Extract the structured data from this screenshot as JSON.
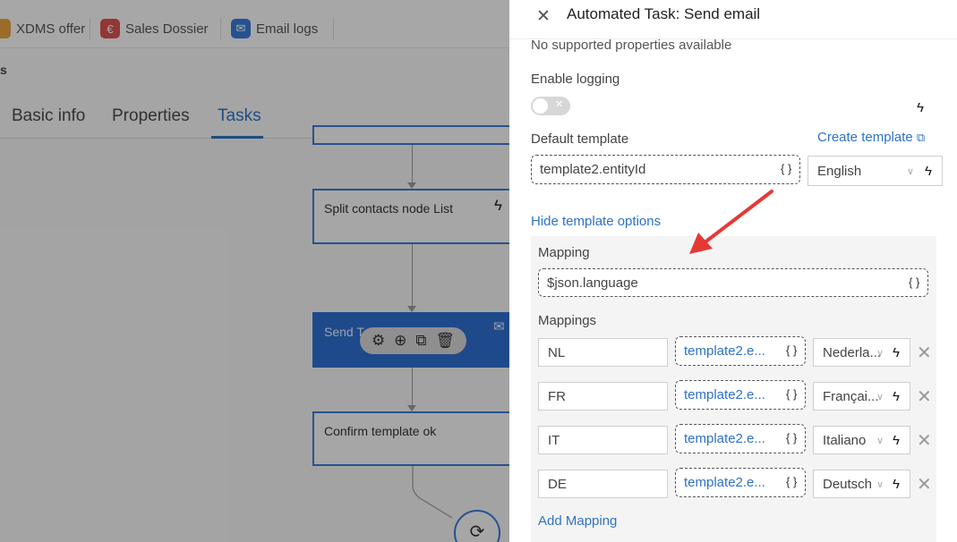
{
  "background": {
    "bookmarks": [
      {
        "label": "XDMS offer",
        "icon": "offer-icon"
      },
      {
        "label": "Sales Dossier",
        "icon": "euro-icon"
      },
      {
        "label": "Email logs",
        "icon": "envelope-icon"
      }
    ],
    "subtitle": "s",
    "tabs": [
      {
        "label": "Basic info"
      },
      {
        "label": "Properties"
      },
      {
        "label": "Tasks"
      }
    ],
    "active_tab": "Tasks",
    "nodes": [
      {
        "label": "Split contacts node List"
      },
      {
        "label": "Send T"
      },
      {
        "label": "Confirm template ok"
      }
    ]
  },
  "drawer": {
    "title": "Automated Task: Send email",
    "no_props": "No supported properties available",
    "logging_label": "Enable logging",
    "logging_enabled": false,
    "default_template_label": "Default template",
    "create_template_link": "Create template",
    "default_template_value": "template2.entityId",
    "default_language": "English",
    "hide_options_link": "Hide template options",
    "mapping_label": "Mapping",
    "mapping_value": "$json.language",
    "mappings_label": "Mappings",
    "mappings": [
      {
        "key": "NL",
        "template": "template2.e...",
        "language": "Nederla..."
      },
      {
        "key": "FR",
        "template": "template2.e...",
        "language": "Françai..."
      },
      {
        "key": "IT",
        "template": "template2.e...",
        "language": "Italiano"
      },
      {
        "key": "DE",
        "template": "template2.e...",
        "language": "Deutsch"
      }
    ],
    "add_mapping_link": "Add Mapping"
  },
  "colors": {
    "accent": "#2f72c4",
    "node_border": "#3a7bd5",
    "selected_node": "#2d6fd0",
    "annotation_arrow": "#e53935"
  }
}
